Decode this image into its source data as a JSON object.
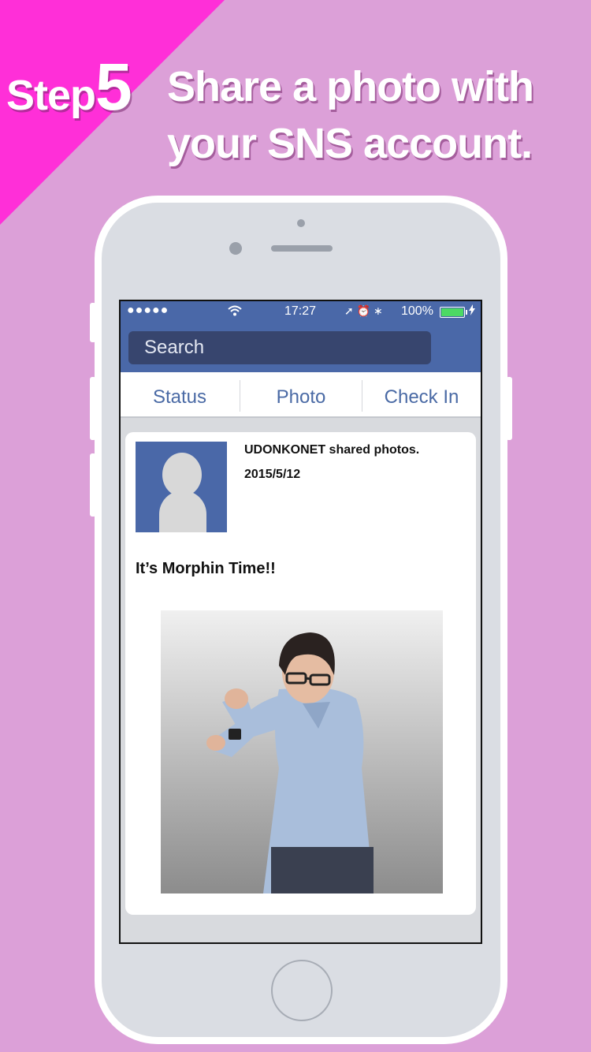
{
  "banner": {
    "step_word": "Step",
    "step_number": "5",
    "headline_line1": "Share a photo with",
    "headline_line2": "your SNS account.",
    "background_color": "#dca0d8",
    "corner_color": "#ff2fd8"
  },
  "status_bar": {
    "signal": "●●●●●",
    "wifi_icon": "wifi-icon",
    "time": "17:27",
    "icons": "➚ ⏰ ∗",
    "battery_text": "100%",
    "charging_icon": "bolt-icon"
  },
  "app": {
    "header_color": "#4a68a8",
    "search_placeholder": "Search",
    "tabs": [
      {
        "label": "Status"
      },
      {
        "label": "Photo"
      },
      {
        "label": "Check In"
      }
    ]
  },
  "post": {
    "author_line": "UDONKONET shared photos.",
    "date": "2015/5/12",
    "text": "It’s Morphin Time!!",
    "avatar_icon": "default-avatar-icon",
    "photo": "man-posing-photo"
  }
}
